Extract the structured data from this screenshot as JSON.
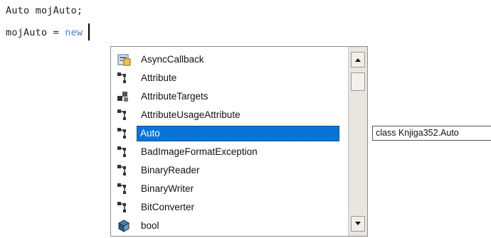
{
  "editor": {
    "line1": "Auto mojAuto;",
    "line2_prefix": "mojAuto = ",
    "line2_keyword": "new"
  },
  "completion_list": {
    "items": [
      {
        "label": "AsyncCallback",
        "icon": "delegate-icon"
      },
      {
        "label": "Attribute",
        "icon": "class-icon"
      },
      {
        "label": "AttributeTargets",
        "icon": "enum-icon"
      },
      {
        "label": "AttributeUsageAttribute",
        "icon": "class-icon"
      },
      {
        "label": "Auto",
        "icon": "class-icon",
        "selected": true
      },
      {
        "label": "BadImageFormatException",
        "icon": "class-icon"
      },
      {
        "label": "BinaryReader",
        "icon": "class-icon"
      },
      {
        "label": "BinaryWriter",
        "icon": "class-icon"
      },
      {
        "label": "BitConverter",
        "icon": "class-icon"
      },
      {
        "label": "bool",
        "icon": "struct-icon"
      }
    ],
    "selection_color": "#0a74d6"
  },
  "tooltip": {
    "text": "class Knjiga352.Auto"
  }
}
